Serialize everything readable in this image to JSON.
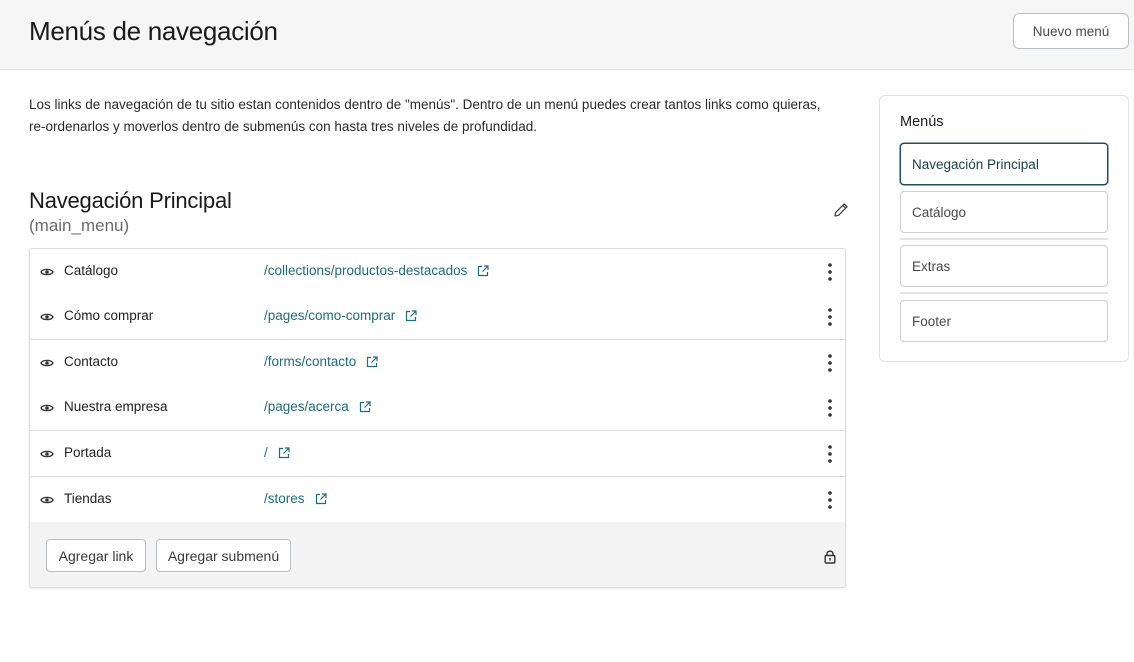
{
  "header": {
    "title": "Menús de navegación",
    "new_menu_label": "Nuevo menú"
  },
  "intro": "Los links de navegación de tu sitio estan contenidos dentro de \"menús\". Dentro de un menú puedes crear tantos links como quieras, re-ordenarlos y moverlos dentro de submenús con hasta tres niveles de profundidad.",
  "menu": {
    "name": "Navegación Principal",
    "handle": "(main_menu)",
    "links": [
      {
        "label": "Catálogo",
        "url": "/collections/productos-destacados",
        "visible_icon": "eye-icon",
        "external_icon": "external-link-icon"
      },
      {
        "label": "Cómo comprar",
        "url": "/pages/como-comprar",
        "visible_icon": "eye-icon",
        "external_icon": "external-link-icon"
      },
      {
        "label": "Contacto",
        "url": "/forms/contacto",
        "visible_icon": "eye-icon",
        "external_icon": "external-link-icon"
      },
      {
        "label": "Nuestra empresa",
        "url": "/pages/acerca",
        "visible_icon": "eye-icon",
        "external_icon": "external-link-icon"
      },
      {
        "label": "Portada",
        "url": "/",
        "visible_icon": "eye-icon",
        "external_icon": "external-link-icon"
      },
      {
        "label": "Tiendas",
        "url": "/stores",
        "visible_icon": "eye-icon",
        "external_icon": "external-link-icon"
      }
    ],
    "add_link_label": "Agregar link",
    "add_submenu_label": "Agregar submenú"
  },
  "sidebar": {
    "title": "Menús",
    "items": [
      {
        "label": "Navegación Principal",
        "active": true
      },
      {
        "label": "Catálogo",
        "active": false
      },
      {
        "label": "Extras",
        "active": false
      },
      {
        "label": "Footer",
        "active": false
      }
    ]
  },
  "colors": {
    "accent": "#1f6d7a",
    "active_border": "#1f4e5c",
    "topbar_bg": "#f6f6f7",
    "footer_bg": "#f4f4f4"
  }
}
